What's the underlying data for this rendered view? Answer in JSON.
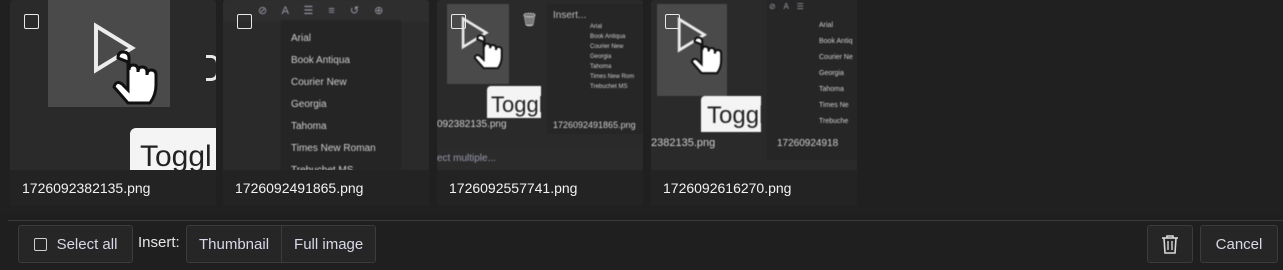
{
  "gallery": {
    "items": [
      {
        "filename": "1726092382135.png"
      },
      {
        "filename": "1726092491865.png"
      },
      {
        "filename": "1726092557741.png"
      },
      {
        "filename": "1726092616270.png"
      }
    ],
    "thumb_text": {
      "toggle_word": "Toggl",
      "insert_word": "Insert...",
      "select_multiple": "ect multiple...",
      "fonts": [
        "Arial",
        "Book Antiqua",
        "Courier New",
        "Georgia",
        "Tahoma",
        "Times New Roman",
        "Trebuchet MS"
      ],
      "fonts_short": [
        "Arial",
        "Book Antiqua",
        "Courier New",
        "Georgia",
        "Tahoma",
        "Times New Rom",
        "Trebuchet MS"
      ],
      "fonts_tiny": [
        "Arial",
        "Book Antiq",
        "Courier Ne",
        "Georgia",
        "Tahoma",
        "Times Ne",
        "Trebuche"
      ],
      "partial_names": [
        "092382135.png",
        "1726092491865.png",
        "2382135.png",
        "17260924918"
      ]
    }
  },
  "toolbar": {
    "select_all_label": "Select all",
    "insert_label": "Insert:",
    "thumbnail_label": "Thumbnail",
    "full_image_label": "Full image",
    "delete_icon": "trash-icon",
    "cancel_label": "Cancel"
  },
  "colors": {
    "background": "#1f1f1f",
    "tile": "#2a2a2a",
    "accent_text": "#d8d8e8"
  }
}
